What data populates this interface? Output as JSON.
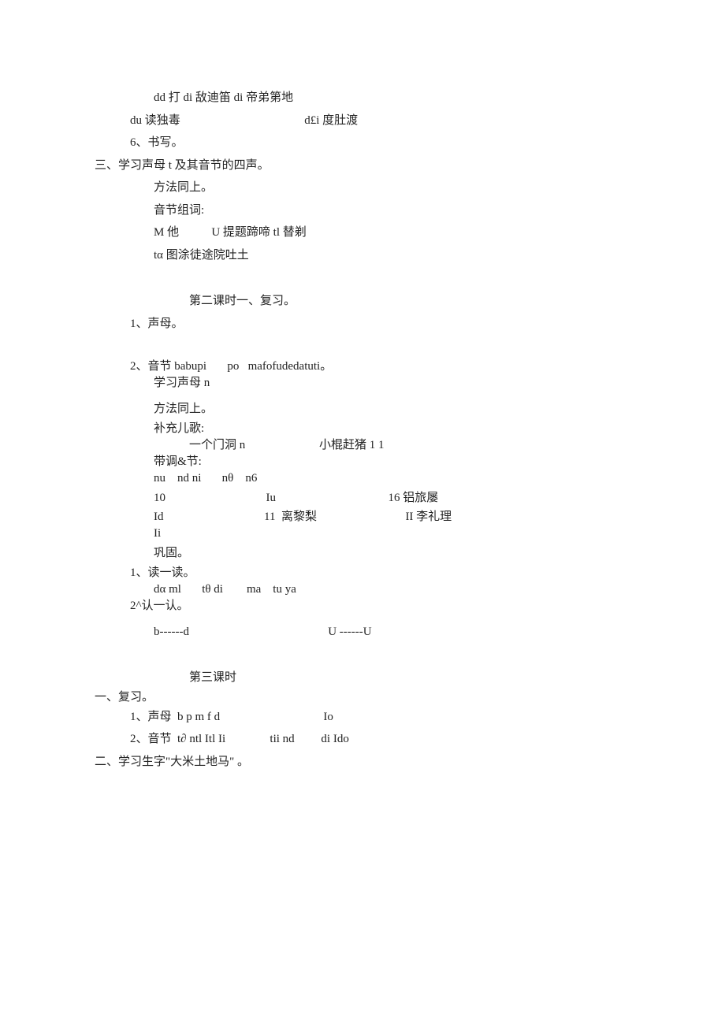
{
  "lines": {
    "l1": "dd 打 di 敌迪笛 di 帝弟第地",
    "l2": "du 读独毒                                          d£i 度肚渡",
    "l3": "6、书写。",
    "l4": "三、学习声母 t 及其音节的四声。",
    "l5": "方法同上。",
    "l6": "音节组词:",
    "l7": "M 他           U 提题蹄啼 tl 替剃",
    "l8": "tα 图涂徒途院吐土",
    "l9": "第二课时一、复习。",
    "l10": "1、声母。",
    "l11": "2、音节 babupi       po   mafofudedatuti。",
    "l12": "学习声母 n",
    "l13": "方法同上。",
    "l14": "补充儿歌:",
    "l15": "一个门洞 n                         小棍赶猪 1 1",
    "l16": "带调&节:",
    "l17": "nu    nd ni       nθ    n6",
    "l18": "10                                  Iu                                      16 铝旅屡",
    "l19": "Id                                  11  离黎梨                              II 李礼理",
    "l20": "Ii",
    "l21": "巩固。",
    "l22": "1、读一读。",
    "l23": "dα ml       tθ di        ma    tu ya",
    "l24": "2^认一认。",
    "l25": "b------d                                               U ------U",
    "l26": "第三课时",
    "l27": "一、复习。",
    "l28": "1、声母  b p m f d                                   Io",
    "l29": "2、音节  t∂ ntl Itl Ii               tii nd         di Ido",
    "l30": "二、学习生字\"大米土地马\" 。"
  }
}
